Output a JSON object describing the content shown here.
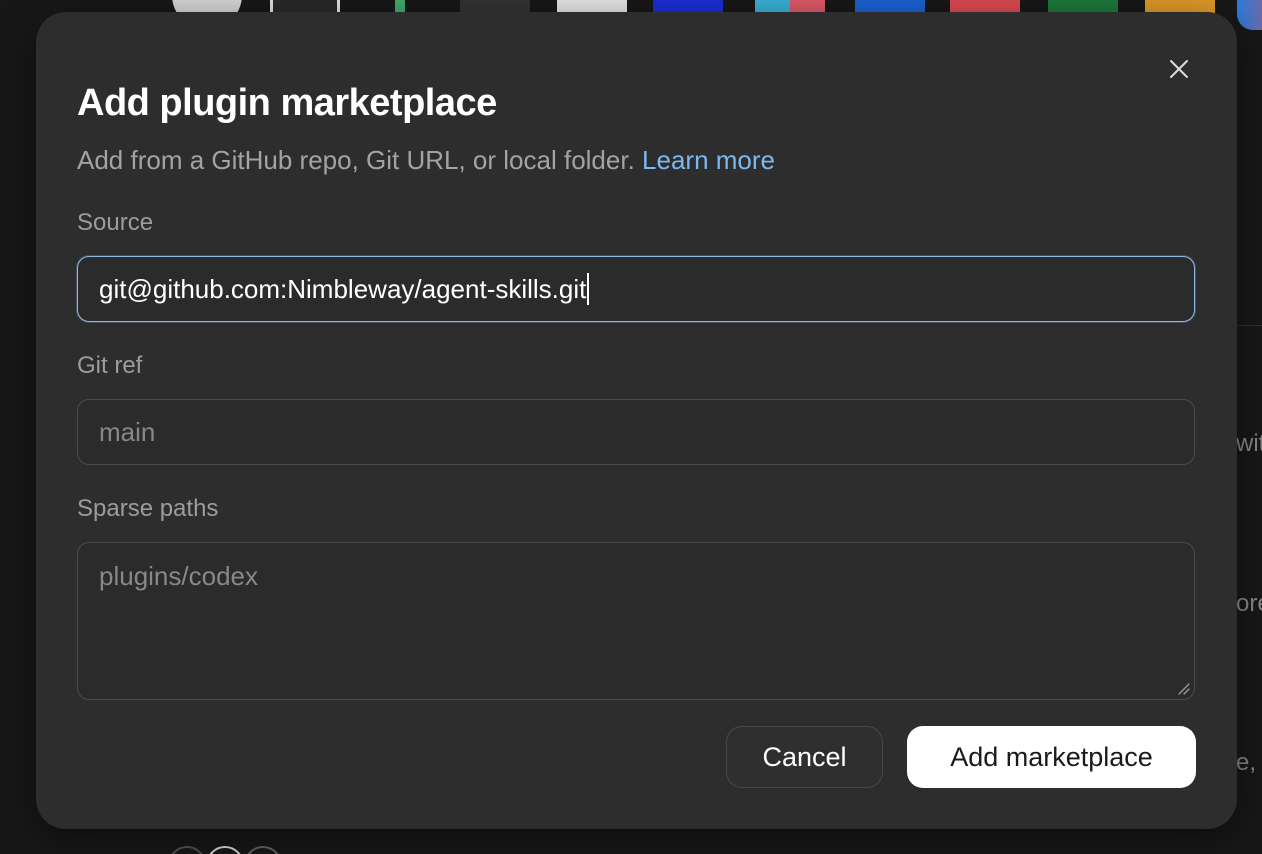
{
  "modal": {
    "title": "Add plugin marketplace",
    "subtitle": "Add from a GitHub repo, Git URL, or local folder.",
    "learn_more": "Learn more",
    "source": {
      "label": "Source",
      "value": "git@github.com:Nimbleway/agent-skills.git"
    },
    "git_ref": {
      "label": "Git ref",
      "placeholder": "main"
    },
    "sparse_paths": {
      "label": "Sparse paths",
      "placeholder": "plugins/codex"
    },
    "buttons": {
      "cancel": "Cancel",
      "primary": "Add marketplace"
    }
  },
  "background": {
    "fragments": [
      "wit",
      "ore",
      "e,"
    ]
  },
  "colors": {
    "modal_bg": "#2d2d2d",
    "link": "#7cb8f0",
    "focus_border": "#8fb8e6",
    "primary_button": "#ffffff"
  },
  "icons": {
    "close": "close-icon",
    "resize": "resize-grip-icon"
  }
}
